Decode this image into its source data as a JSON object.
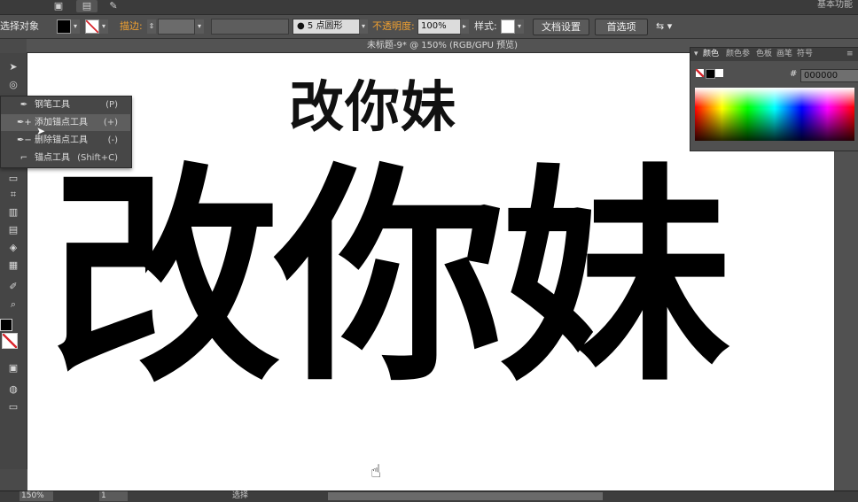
{
  "menubar": {
    "icons": [
      "document-icon",
      "brush-icon"
    ],
    "workspace_label": "基本功能"
  },
  "control_bar": {
    "selection_label": "选择对象",
    "stroke_label": "描边:",
    "brush_value": "5 点圆形",
    "opacity_label": "不透明度:",
    "opacity_value": "100%",
    "style_label": "样式:",
    "doc_setup_button": "文档设置",
    "preferences_button": "首选项",
    "colors": {
      "fill": "#000000",
      "stroke_accent": "#d9282f",
      "label_accent": "#f0a030"
    }
  },
  "document": {
    "tab_title": "未标题-9* @ 150% (RGB/GPU 预览)"
  },
  "canvas": {
    "small_heading": "改你妹",
    "big_heading": "改你妹"
  },
  "tool_flyout": {
    "items": [
      {
        "label": "钢笔工具",
        "shortcut": "(P)",
        "icon": "pen-icon"
      },
      {
        "label": "添加锚点工具",
        "shortcut": "(+)",
        "icon": "add-anchor-point-icon"
      },
      {
        "label": "删除锚点工具",
        "shortcut": "(-)",
        "icon": "delete-anchor-point-icon"
      },
      {
        "label": "锚点工具",
        "shortcut": "(Shift+C)",
        "icon": "anchor-point-icon"
      }
    ],
    "selected_index": 1
  },
  "color_panel": {
    "tabs": [
      "颜色",
      "颜色参",
      "色板",
      "画笔",
      "符号"
    ],
    "hex_label": "#",
    "hex_value": "000000"
  },
  "status_bar": {
    "zoom": "150%",
    "page": "1",
    "mode": "选择"
  }
}
